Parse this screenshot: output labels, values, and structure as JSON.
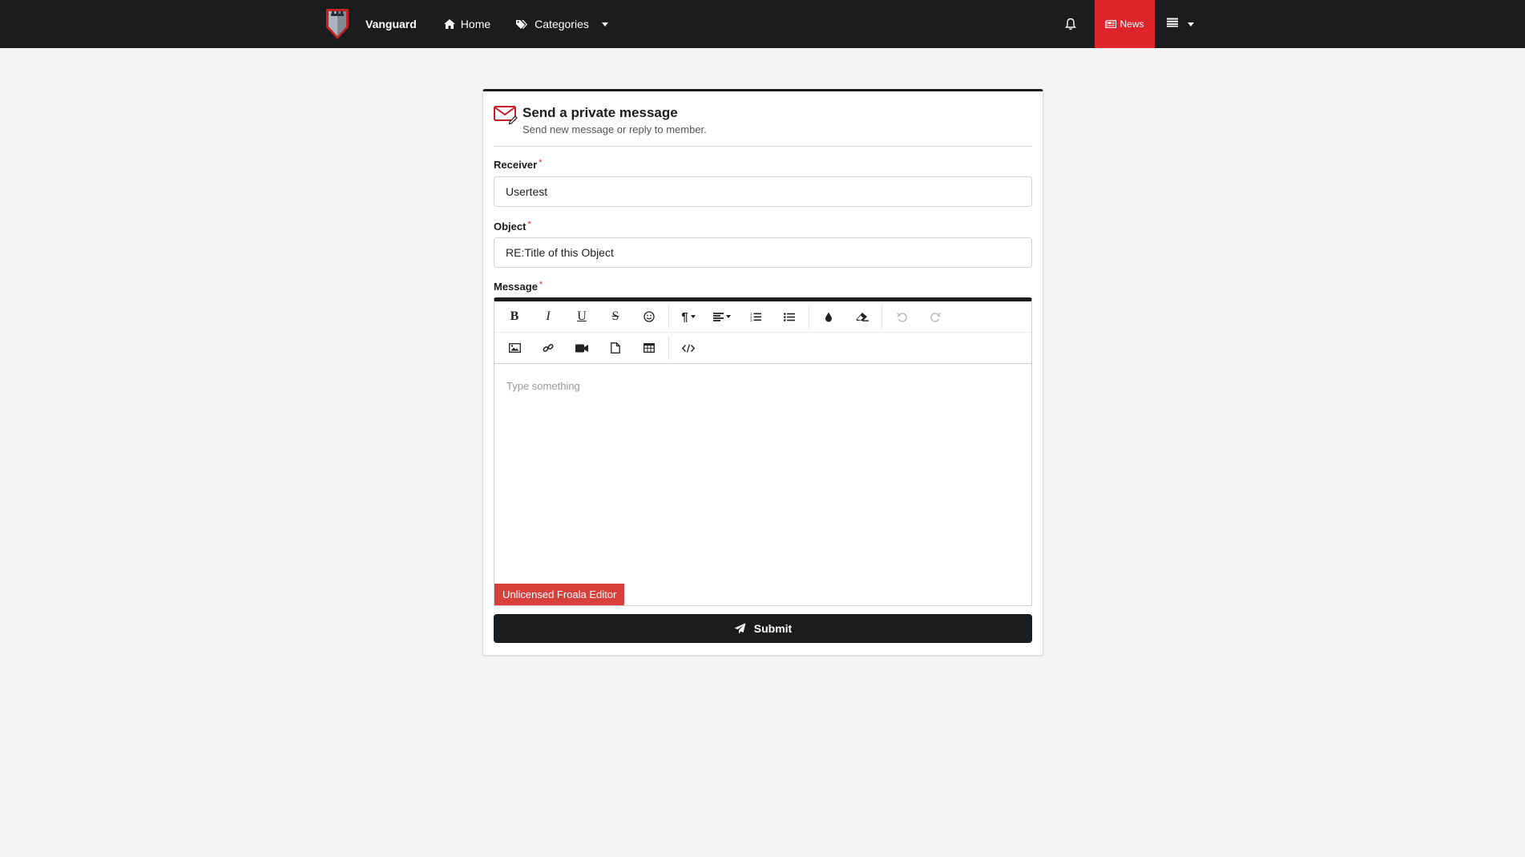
{
  "navbar": {
    "brand": "Vanguard",
    "home_label": "Home",
    "categories_label": "Categories",
    "news_label": "News"
  },
  "card": {
    "title": "Send a private message",
    "subtitle": "Send new message or reply to member."
  },
  "form": {
    "receiver_label": "Receiver",
    "receiver_value": "Usertest",
    "object_label": "Object",
    "object_value": "RE:Title of this Object",
    "message_label": "Message",
    "required_mark": "*"
  },
  "editor": {
    "placeholder": "Type something",
    "badge": "Unlicensed Froala Editor",
    "toolbar_row1": [
      "bold-icon",
      "italic-icon",
      "underline-icon",
      "strikethrough-icon",
      "emoticon-icon",
      "paragraph-format-icon",
      "align-icon",
      "ordered-list-icon",
      "unordered-list-icon",
      "color-icon",
      "clear-formatting-icon",
      "undo-icon",
      "redo-icon"
    ],
    "toolbar_row2": [
      "insert-image-icon",
      "insert-link-icon",
      "insert-video-icon",
      "insert-file-icon",
      "insert-table-icon",
      "code-view-icon"
    ]
  },
  "submit_label": "Submit",
  "colors": {
    "navbar": "#1b1c1d",
    "accent_red": "#e0242b",
    "froala_badge": "#d9403b",
    "page_bg": "#f4f4f4"
  }
}
